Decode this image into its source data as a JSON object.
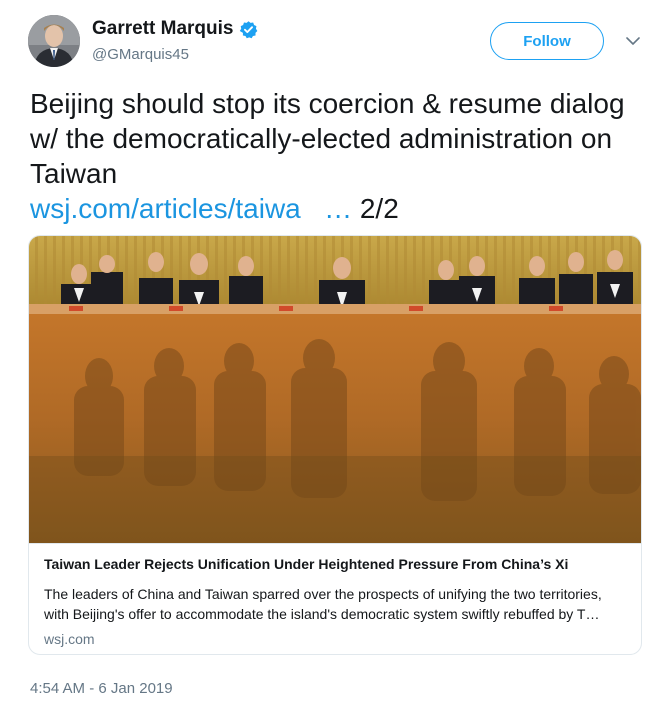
{
  "author": {
    "name": "Garrett Marquis",
    "handle": "@GMarquis45",
    "verified_icon": "verified-badge-icon",
    "avatar_icon": "profile-photo"
  },
  "follow_button": {
    "label": "Follow"
  },
  "menu": {
    "icon": "chevron-down-icon"
  },
  "tweet": {
    "text": "Beijing should stop its coercion & resume dialog w/ the democratically-elected administration on Taiwan",
    "link_text": "wsj.com/articles/taiwa",
    "ellipsis": "…",
    "suffix": "2/2"
  },
  "card": {
    "image": "photo of officials seated at a conference dais behind a tinted glass partition",
    "title": "Taiwan Leader Rejects Unification Under Heightened Pressure From China’s Xi",
    "description": "The leaders of China and Taiwan sparred over the prospects of unifying the two territories, with Beijing's offer to accommodate the island's democratic system swiftly rebuffed by T…",
    "domain": "wsj.com"
  },
  "timestamp": "4:54 AM - 6 Jan 2019",
  "colors": {
    "accent": "#1da1f2",
    "link": "#1b95e0",
    "secondary_text": "#657786",
    "border": "#e1e8ed"
  }
}
